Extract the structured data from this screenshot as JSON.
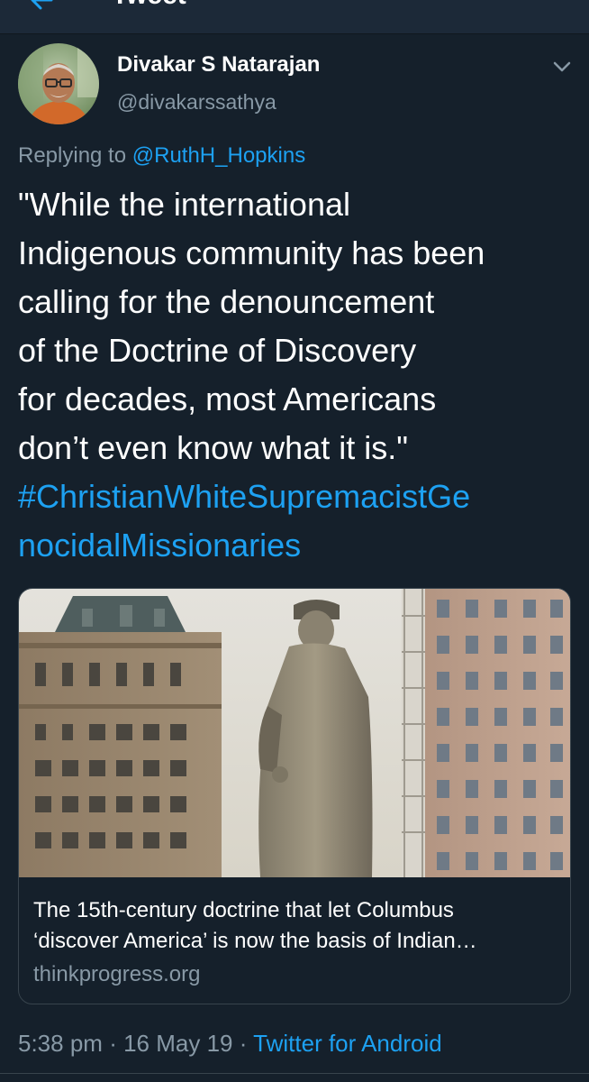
{
  "header": {
    "title": "Tweet",
    "back_icon": "back-arrow-icon"
  },
  "tweet": {
    "author_name": "Divakar S Natarajan",
    "author_handle": "@divakarssathya",
    "menu_icon": "chevron-down-icon",
    "replying_prefix": "Replying to",
    "replying_handle": "@RuthH_Hopkins",
    "text_lines": [
      "\"While the international",
      "Indigenous community has been",
      "calling for the denouncement",
      "of the Doctrine of Discovery",
      "for decades, most Americans",
      "don’t even know what it is.\""
    ],
    "hashtag_lines": [
      "#ChristianWhiteSupremacistGe",
      "nocidalMissionaries"
    ],
    "time": "5:38 pm",
    "separator": "·",
    "date": "16 May 19",
    "source": "Twitter for Android"
  },
  "link_card": {
    "title_lines": [
      "The 15th-century doctrine that let Columbus",
      "‘discover America’ is now the basis of Indian…"
    ],
    "domain": "thinkprogress.org"
  },
  "colors": {
    "background": "#15202b",
    "text_primary": "#ffffff",
    "text_secondary": "#8899a6",
    "accent": "#1da1f2",
    "border": "#38444d"
  }
}
